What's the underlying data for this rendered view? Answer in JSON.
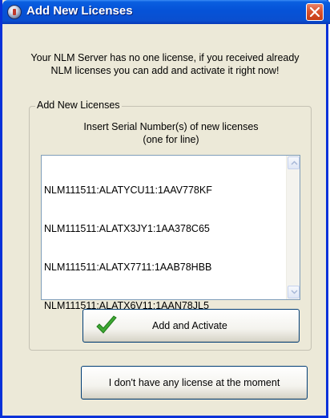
{
  "window": {
    "title": "Add New Licenses",
    "icon": "nlm-app-icon",
    "close_icon": "close-icon"
  },
  "message": "Your NLM Server has no one license, if you received already NLM licenses you can add and activate it right now!",
  "group": {
    "label": "Add New Licenses",
    "instructions_line1": "Insert Serial Number(s) of new licenses",
    "instructions_line2": "(one for line)"
  },
  "serials": [
    "NLM111511:ALATYCU11:1AAV778KF",
    "NLM111511:ALATX3JY1:1AA378C65",
    "NLM111511:ALATX7711:1AAB78HBB",
    "NLM111511:ALATX6V11:1AAN78JL5"
  ],
  "buttons": {
    "activate_label": "Add and Activate",
    "activate_icon": "checkmark-icon",
    "no_license_label": "I don't have any license at the moment"
  },
  "colors": {
    "titlebar": "#0553d8",
    "window_bg": "#ece9d8",
    "close_button": "#d9532e",
    "check_green": "#3ea832"
  }
}
